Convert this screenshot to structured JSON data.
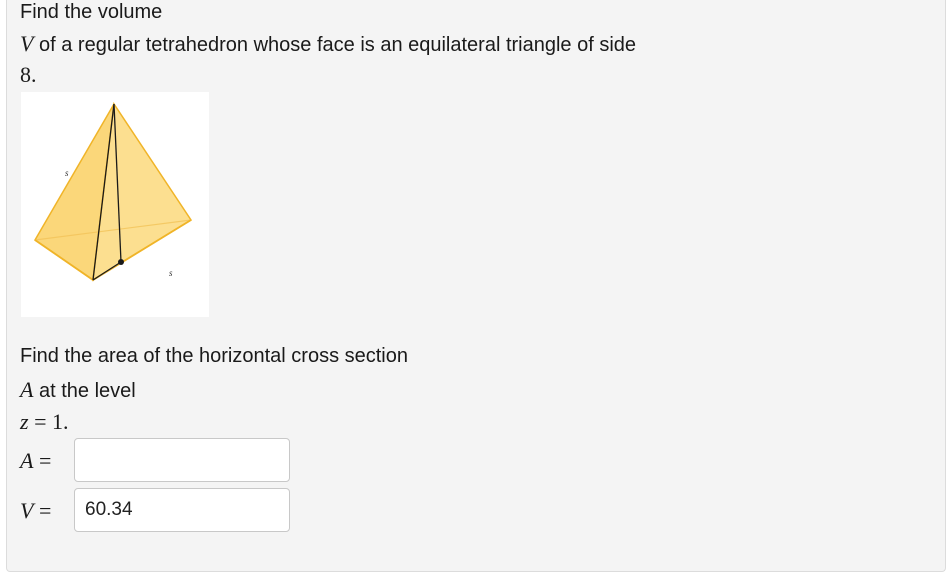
{
  "question": {
    "line1": "Find the volume",
    "line2_var": "V",
    "line2_text": " of a regular tetrahedron whose face is an equilateral triangle of side",
    "line3": "8."
  },
  "figure": {
    "edge_label_left": "s",
    "edge_label_right": "s",
    "fill_color": "#fbd77a",
    "edge_color": "#f0b428",
    "inner_line_color": "#1a1a1a"
  },
  "cross_section": {
    "line1": "Find the area of the horizontal cross section",
    "line2_var": "A",
    "line2_text": " at the level",
    "line3_var": "z",
    "line3_eq": " = 1."
  },
  "answers": {
    "a_var": "A",
    "a_eq": " =",
    "a_value": "",
    "v_var": "V",
    "v_eq": " =",
    "v_value": "60.34"
  }
}
